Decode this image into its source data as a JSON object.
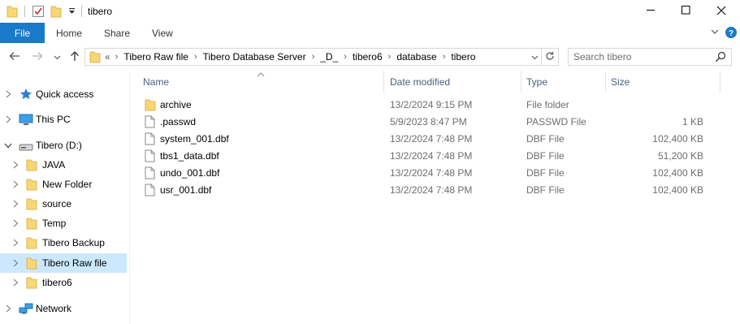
{
  "window": {
    "title": "tibero",
    "controls": [
      "minimize-icon",
      "maximize-icon",
      "close-icon"
    ]
  },
  "quick_access_toolbar": [
    "folder-icon",
    "properties-icon",
    "new-folder-icon",
    "customize-dropdown-icon"
  ],
  "ribbon": {
    "tabs": [
      "File",
      "Home",
      "Share",
      "View"
    ],
    "active_tab": "File",
    "accent_color": "#1979ca"
  },
  "navigation": {
    "back": "back-arrow-icon",
    "forward": "forward-arrow-icon",
    "recent": "chevron-down-icon",
    "up": "up-arrow-icon"
  },
  "address_bar": {
    "overflow": "«",
    "crumbs": [
      "Tibero Raw file",
      "Tibero Database Server",
      "_D_",
      "tibero6",
      "database",
      "tibero"
    ]
  },
  "search": {
    "placeholder": "Search tibero"
  },
  "nav_pane": {
    "items": [
      {
        "label": "Quick access",
        "icon": "star-icon",
        "level": 0,
        "expanded": false
      },
      {
        "label": "This PC",
        "icon": "computer-icon",
        "level": 0,
        "expanded": false
      },
      {
        "label": "Tibero (D:)",
        "icon": "drive-icon",
        "level": 0,
        "expanded": true
      },
      {
        "label": "JAVA",
        "icon": "folder-icon",
        "level": 1,
        "expanded": false
      },
      {
        "label": "New Folder",
        "icon": "folder-icon",
        "level": 1,
        "expanded": false
      },
      {
        "label": "source",
        "icon": "folder-icon",
        "level": 1,
        "expanded": false
      },
      {
        "label": "Temp",
        "icon": "folder-icon",
        "level": 1,
        "expanded": false
      },
      {
        "label": "Tibero Backup",
        "icon": "folder-icon",
        "level": 1,
        "expanded": false
      },
      {
        "label": "Tibero Raw file",
        "icon": "folder-icon",
        "level": 1,
        "expanded": false,
        "selected": true
      },
      {
        "label": "tibero6",
        "icon": "folder-icon",
        "level": 1,
        "expanded": false
      },
      {
        "label": "Network",
        "icon": "network-icon",
        "level": 0,
        "expanded": false
      }
    ],
    "selected_color": "#cce8ff"
  },
  "file_list": {
    "columns": [
      "Name",
      "Date modified",
      "Type",
      "Size"
    ],
    "sorted_by": "Name",
    "rows": [
      {
        "name": "archive",
        "date": "13/2/2024 9:15 PM",
        "type": "File folder",
        "size": "",
        "icon": "folder-icon"
      },
      {
        "name": ".passwd",
        "date": "5/9/2023 8:47 PM",
        "type": "PASSWD File",
        "size": "1 KB",
        "icon": "file-icon"
      },
      {
        "name": "system_001.dbf",
        "date": "13/2/2024 7:48 PM",
        "type": "DBF File",
        "size": "102,400 KB",
        "icon": "file-icon"
      },
      {
        "name": "tbs1_data.dbf",
        "date": "13/2/2024 7:48 PM",
        "type": "DBF File",
        "size": "51,200 KB",
        "icon": "file-icon"
      },
      {
        "name": "undo_001.dbf",
        "date": "13/2/2024 7:48 PM",
        "type": "DBF File",
        "size": "102,400 KB",
        "icon": "file-icon"
      },
      {
        "name": "usr_001.dbf",
        "date": "13/2/2024 7:48 PM",
        "type": "DBF File",
        "size": "102,400 KB",
        "icon": "file-icon"
      }
    ]
  },
  "colors": {
    "folder": "#f8d775",
    "header_text": "#4c607a",
    "secondary_text": "#6d6d6d"
  }
}
